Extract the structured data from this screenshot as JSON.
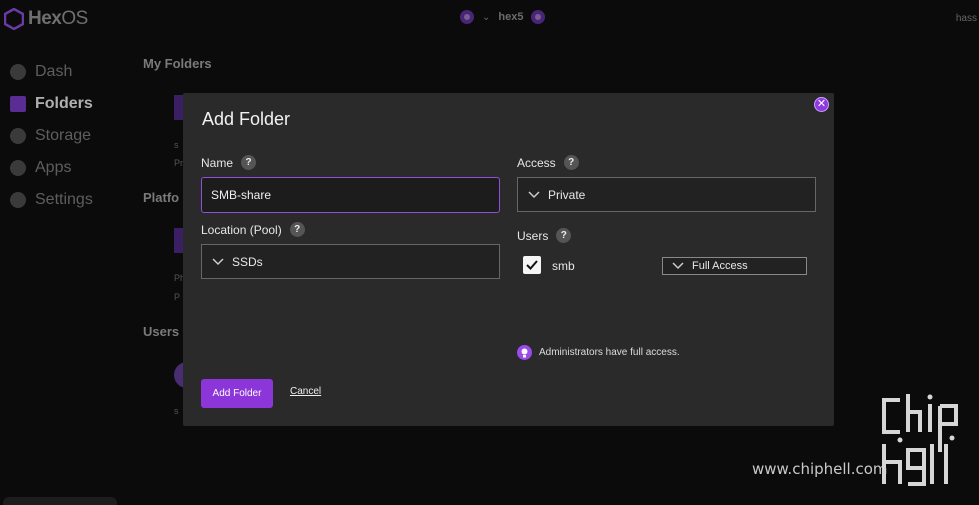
{
  "app": {
    "logo_text": "Hex",
    "logo_suffix": "OS",
    "host": "hex5",
    "user_partial": "hass"
  },
  "sidebar": {
    "items": [
      {
        "label": "Dash",
        "icon": "dashboard-icon"
      },
      {
        "label": "Folders",
        "icon": "folder-icon",
        "active": true
      },
      {
        "label": "Storage",
        "icon": "storage-icon"
      },
      {
        "label": "Apps",
        "icon": "apps-icon"
      },
      {
        "label": "Settings",
        "icon": "gear-icon"
      }
    ]
  },
  "background": {
    "my_folders_heading": "My Folders",
    "platform_heading": "Platfo",
    "users_heading": "Users",
    "card1_line1": "s",
    "card1_line2": "Pr",
    "card2_line1": "Ph",
    "card2_line2": "P",
    "avatar_caption": "s"
  },
  "modal": {
    "title": "Add Folder",
    "close_icon": "close-icon",
    "name_label": "Name",
    "name_value": "SMB-share",
    "location_label": "Location (Pool)",
    "location_value": "SSDs",
    "access_label": "Access",
    "access_value": "Private",
    "users_label": "Users",
    "users": [
      {
        "name": "smb",
        "checked": true,
        "permission": "Full Access"
      }
    ],
    "admin_note": "Administrators have full access.",
    "submit_label": "Add Folder",
    "cancel_label": "Cancel",
    "help_glyph": "?"
  },
  "watermark": {
    "url": "www.chiphell.com"
  },
  "colors": {
    "accent": "#8c35d8",
    "modal_bg": "#2a2a2a",
    "page_bg": "#0b0b0b"
  }
}
